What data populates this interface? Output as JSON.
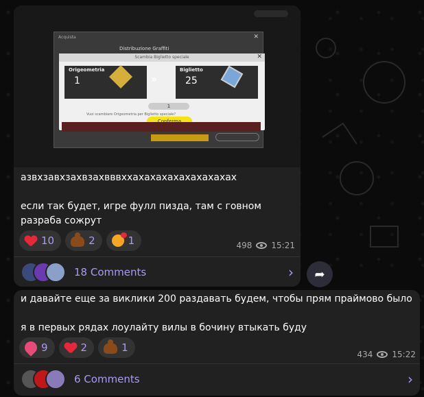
{
  "posts": [
    {
      "game_screenshot": {
        "window_title": "Acquista",
        "distribution_title": "Distribuzione Graffiti",
        "dialog_title": "Scambia Biglietto speciale",
        "left_label": "Origeometria",
        "left_amount": "1",
        "right_label": "Biglietto",
        "right_amount": "25",
        "stepper_value": "1",
        "question": "Vuoi scambiare Origeometria per Biglietto speciale?",
        "confirm_label": "Conferma",
        "arrow_glyph": "»"
      },
      "text": "азвхзавхзахвзахвввххахахахахахахахахах\n\nесли так будет, игре фулл пизда, там с говном\nразраба сожрут",
      "reactions": [
        {
          "icon": "heart-icon",
          "count": "10"
        },
        {
          "icon": "poop-icon",
          "count": "2"
        },
        {
          "icon": "kissing-face-icon",
          "count": "1"
        }
      ],
      "views": "498",
      "time": "15:21",
      "comments_label": "18 Comments",
      "avatar_colors": [
        "#3a4a7a",
        "#6a3ab0",
        "#8aa0c8"
      ]
    },
    {
      "text": "и давайте еще за виклики 200 раздавать будем, чтобы прям праймово было\n\nя в первых рядах лоулайту вилы в бочину втыкать буду",
      "reactions": [
        {
          "icon": "heart-arrow-icon",
          "count": "9"
        },
        {
          "icon": "heart-icon",
          "count": "2"
        },
        {
          "icon": "poop-icon",
          "count": "1"
        }
      ],
      "views": "434",
      "time": "15:22",
      "comments_label": "6 Comments",
      "avatar_colors": [
        "#555555",
        "#c01818",
        "#8a7ab8"
      ]
    }
  ],
  "accent_color": "#a99bf5"
}
